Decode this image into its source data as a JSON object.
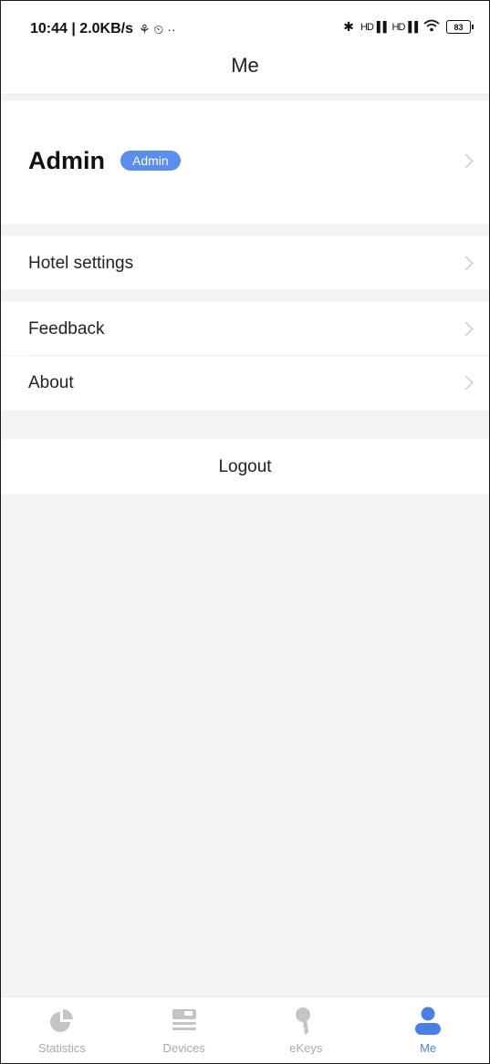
{
  "status_bar": {
    "time_speed": "10:44 | 2.0KB/s",
    "left_icons": "⚘ ⏲ ··",
    "signal1": "HD",
    "signal2": "HD",
    "battery": "83"
  },
  "header": {
    "title": "Me"
  },
  "profile": {
    "name": "Admin",
    "role_badge": "Admin"
  },
  "menu": {
    "hotel_settings": "Hotel settings",
    "feedback": "Feedback",
    "about": "About",
    "logout": "Logout"
  },
  "tabs": [
    {
      "label": "Statistics",
      "icon": "pie-chart-icon",
      "active": false
    },
    {
      "label": "Devices",
      "icon": "devices-icon",
      "active": false
    },
    {
      "label": "eKeys",
      "icon": "key-icon",
      "active": false
    },
    {
      "label": "Me",
      "icon": "person-icon",
      "active": true
    }
  ],
  "colors": {
    "accent": "#4a7fe6",
    "badge": "#5b8def",
    "inactive_tab": "#bdbdbd",
    "background": "#f4f4f4"
  }
}
